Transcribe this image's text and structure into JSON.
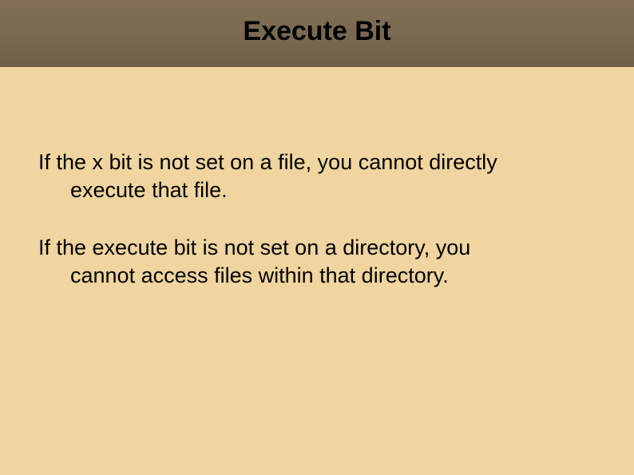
{
  "header": {
    "title": "Execute Bit"
  },
  "body": {
    "p1_line1": "If the x bit is not set on a file, you cannot directly",
    "p1_line2": "execute that file.",
    "p2_line1": "If the execute bit is not set on a directory, you",
    "p2_line2": "cannot access files within that directory."
  }
}
